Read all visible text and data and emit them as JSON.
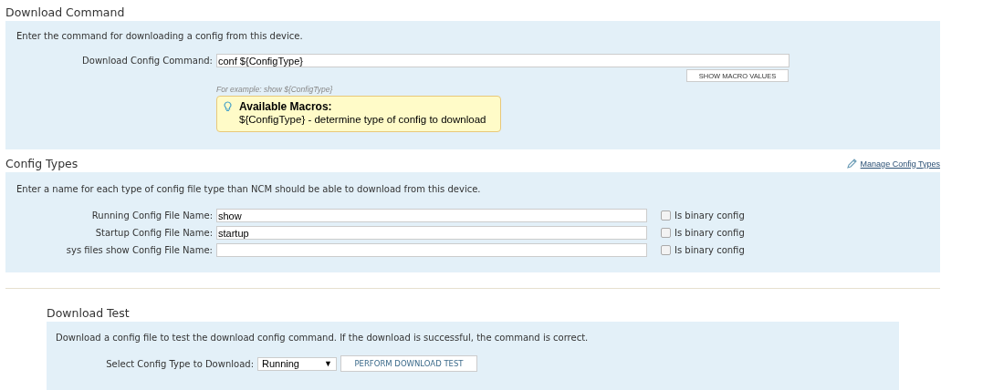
{
  "download_command": {
    "title": "Download Command",
    "description": "Enter the command for downloading a config from this device.",
    "command_label": "Download Config Command:",
    "command_value": "conf ${ConfigType}",
    "macro_button": "SHOW MACRO VALUES",
    "example": "For example: show ${ConfigType}",
    "macros": {
      "title": "Available Macros:",
      "text": "${ConfigType} - determine type of config to download"
    }
  },
  "config_types": {
    "title": "Config Types",
    "manage_link": "Manage Config Types",
    "description": "Enter a name for each type of config file type than NCM should be able to download from this device.",
    "rows": [
      {
        "label": "Running Config File Name:",
        "value": "show",
        "binary_label": "Is binary config",
        "checked": false
      },
      {
        "label": "Startup Config File Name:",
        "value": "startup",
        "binary_label": "Is binary config",
        "checked": false
      },
      {
        "label": "sys files show Config File Name:",
        "value": "",
        "binary_label": "Is binary config",
        "checked": false
      }
    ]
  },
  "download_test": {
    "title": "Download Test",
    "description": "Download a config file to test the download config command. If the download is successful, the command is correct.",
    "select_label": "Select Config Type to Download:",
    "select_value": "Running",
    "select_arrow": "▼",
    "button": "PERFORM DOWNLOAD TEST"
  }
}
